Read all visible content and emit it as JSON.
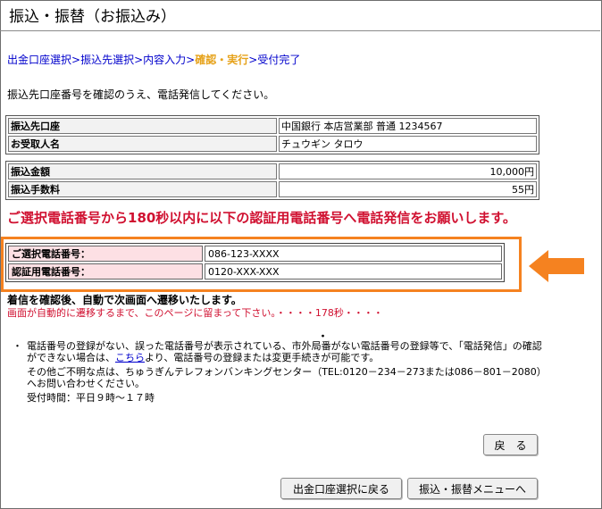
{
  "title": "振込・振替（お振込み）",
  "steps": {
    "s1": "出金口座選択",
    "s2": "振込先選択",
    "s3": "内容入力",
    "s4": "確認・実行",
    "s5": "受付完了",
    "sep": ">"
  },
  "instruction": "振込先口座番号を確認のうえ、電話発信してください。",
  "payee_table": {
    "row1_label": "振込先口座",
    "row1_value": "中国銀行 本店営業部 普通 1234567",
    "row2_label": "お受取人名",
    "row2_value": "チュウギン タロウ"
  },
  "amount_table": {
    "row1_label": "振込金額",
    "row1_value": "10,000円",
    "row2_label": "振込手数料",
    "row2_value": "55円"
  },
  "warning": "ご選択電話番号から180秒以内に以下の認証用電話番号へ電話発信をお願いします。",
  "phones": {
    "selected_label": "ご選択電話番号：",
    "selected_value": "086-123-XXXX",
    "auth_label": "認証用電話番号：",
    "auth_value": "0120-XXX-XXX"
  },
  "notice_bold": "着信を確認後、自動で次画面へ遷移いたします。",
  "notice_red": "画面が自動的に遷移するまで、このページに留まって下さい。・・・・178秒・・・・",
  "dot": "・",
  "notes": {
    "bullet": "・",
    "p1_pre": "電話番号の登録がない、誤った電話番号が表示されている、市外局番がない電話番号の登録等で、「電話発信」の確認ができない場合は、",
    "p1_link": "こちら",
    "p1_post": "より、電話番号の登録または変更手続きが可能です。",
    "p2": "その他ご不明な点は、ちゅうぎんテレフォンバンキングセンター（TEL:0120－234－273または086－801－2080）へお問い合わせください。",
    "p3": "受付時間：平日９時～１７時"
  },
  "buttons": {
    "back": "戻　る",
    "to_account_select": "出金口座選択に戻る",
    "to_menu": "振込・振替メニューへ"
  },
  "colors": {
    "accent_orange": "#f58220",
    "warning_red": "#d01030",
    "link_blue": "#0000cc",
    "current_step": "#e6a21a",
    "label_pink": "#fde0e4"
  },
  "icons": {
    "pointer": "arrow-left-icon"
  }
}
